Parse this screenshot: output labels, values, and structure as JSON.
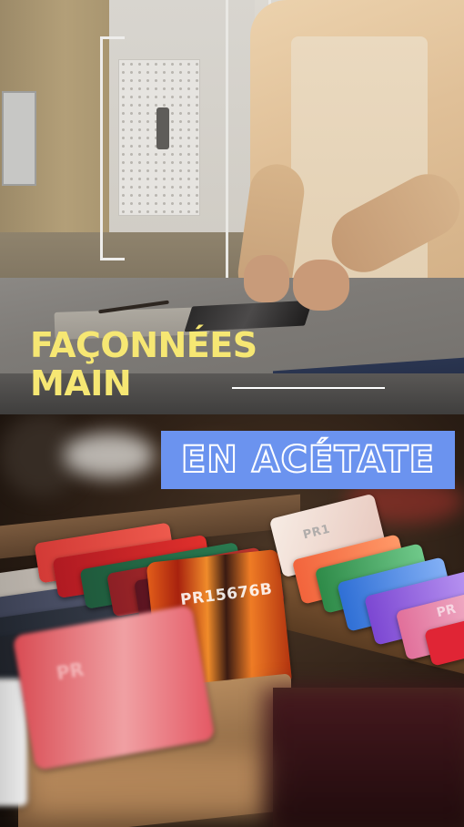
{
  "top_panel": {
    "title_line1": "FAÇONNÉES",
    "title_line2": "MAIN"
  },
  "bottom_panel": {
    "banner_text": "EN ACÉTATE",
    "sheet_label_main": "PR15676B",
    "sheet_label_back": "PR1",
    "sheet_label_pink": "PR",
    "sheet_label_right": "PR"
  },
  "colors": {
    "title_yellow": "#f6e773",
    "banner_blue": "#6b93ef",
    "divider_white": "#ffffff"
  }
}
